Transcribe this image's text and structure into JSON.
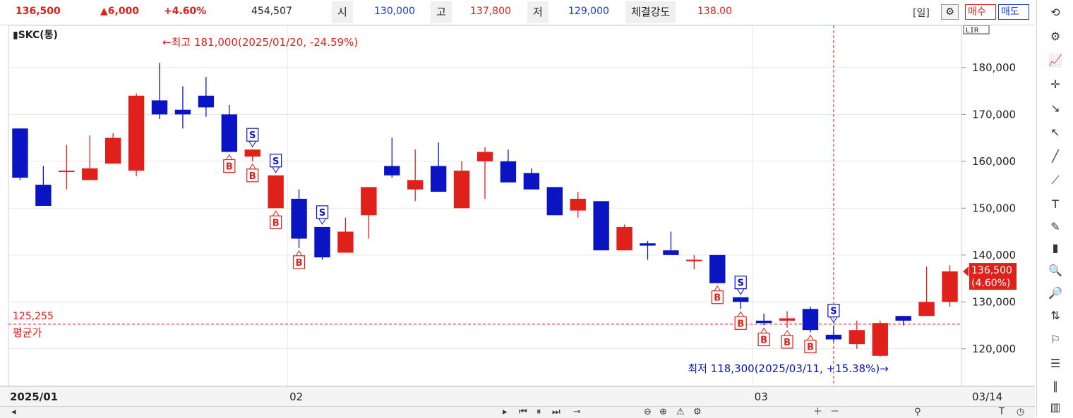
{
  "header": {
    "price": "136,500",
    "change": "▲6,000",
    "change_pct": "+4.60%",
    "volume": "454,507",
    "open_label": "시",
    "open": "130,000",
    "high_label": "고",
    "high": "137,800",
    "low_label": "저",
    "low": "129,000",
    "strength_label": "체결강도",
    "strength": "138.00",
    "period": "[일]",
    "buy_label": "매수",
    "sell_label": "매도"
  },
  "colors": {
    "up": "#e0201a",
    "down": "#0a14c2",
    "avg": "#e0201a",
    "grid": "#e6e6e6"
  },
  "chart_data": {
    "type": "candlestick",
    "symbol_label": "SKC(통)",
    "scale_badge": "LIR",
    "ylim": [
      112000,
      189000
    ],
    "yticks": [
      120000,
      130000,
      140000,
      150000,
      160000,
      170000,
      180000
    ],
    "ytick_labels": [
      "120,000",
      "130,000",
      "140,000",
      "150,000",
      "160,000",
      "170,000",
      "180,000"
    ],
    "x_labels": [
      {
        "index": 0,
        "text": "2025/01"
      },
      {
        "index": 12,
        "text": "02"
      },
      {
        "index": 32,
        "text": "03"
      },
      {
        "index": 43,
        "text": "03/14"
      }
    ],
    "candles": [
      {
        "o": 167000,
        "h": 167000,
        "l": 156000,
        "c": 156500
      },
      {
        "o": 155000,
        "h": 159000,
        "l": 150500,
        "c": 150500
      },
      {
        "o": 158000,
        "h": 163500,
        "l": 154000,
        "c": 158000
      },
      {
        "o": 156000,
        "h": 165500,
        "l": 156000,
        "c": 158500
      },
      {
        "o": 159500,
        "h": 166000,
        "l": 159500,
        "c": 165000
      },
      {
        "o": 158000,
        "h": 174500,
        "l": 156800,
        "c": 174000
      },
      {
        "o": 173000,
        "h": 181000,
        "l": 169000,
        "c": 170000
      },
      {
        "o": 171000,
        "h": 176000,
        "l": 167000,
        "c": 170000
      },
      {
        "o": 174000,
        "h": 178000,
        "l": 169500,
        "c": 171500
      },
      {
        "o": 170000,
        "h": 172000,
        "l": 162000,
        "c": 162000
      },
      {
        "o": 161000,
        "h": 162500,
        "l": 160000,
        "c": 162500
      },
      {
        "o": 150000,
        "h": 157000,
        "l": 150000,
        "c": 157000
      },
      {
        "o": 152000,
        "h": 154000,
        "l": 141500,
        "c": 143500
      },
      {
        "o": 146000,
        "h": 146000,
        "l": 139000,
        "c": 139500
      },
      {
        "o": 140500,
        "h": 148000,
        "l": 140500,
        "c": 145000
      },
      {
        "o": 148500,
        "h": 154500,
        "l": 143500,
        "c": 154500
      },
      {
        "o": 159000,
        "h": 165000,
        "l": 156500,
        "c": 157000
      },
      {
        "o": 154000,
        "h": 162500,
        "l": 151500,
        "c": 156000
      },
      {
        "o": 159000,
        "h": 164000,
        "l": 153500,
        "c": 153500
      },
      {
        "o": 150000,
        "h": 160000,
        "l": 150000,
        "c": 158000
      },
      {
        "o": 160000,
        "h": 163000,
        "l": 152000,
        "c": 162000
      },
      {
        "o": 160000,
        "h": 162500,
        "l": 155500,
        "c": 155500
      },
      {
        "o": 157500,
        "h": 158500,
        "l": 154000,
        "c": 154000
      },
      {
        "o": 154500,
        "h": 154500,
        "l": 148500,
        "c": 148500
      },
      {
        "o": 149500,
        "h": 153500,
        "l": 148000,
        "c": 152000
      },
      {
        "o": 151500,
        "h": 151500,
        "l": 141000,
        "c": 141000
      },
      {
        "o": 141000,
        "h": 146500,
        "l": 141000,
        "c": 146000
      },
      {
        "o": 142500,
        "h": 143000,
        "l": 139000,
        "c": 142000
      },
      {
        "o": 141000,
        "h": 145000,
        "l": 140500,
        "c": 140000
      },
      {
        "o": 139000,
        "h": 140000,
        "l": 137000,
        "c": 139000
      },
      {
        "o": 140000,
        "h": 140000,
        "l": 134000,
        "c": 134000
      },
      {
        "o": 131000,
        "h": 131000,
        "l": 128500,
        "c": 130000
      },
      {
        "o": 126000,
        "h": 127500,
        "l": 125000,
        "c": 125500
      },
      {
        "o": 126000,
        "h": 128000,
        "l": 124500,
        "c": 126500
      },
      {
        "o": 128500,
        "h": 129000,
        "l": 123500,
        "c": 124000
      },
      {
        "o": 123000,
        "h": 125000,
        "l": 121500,
        "c": 122000
      },
      {
        "o": 121000,
        "h": 126000,
        "l": 120000,
        "c": 124000
      },
      {
        "o": 118500,
        "h": 126000,
        "l": 118300,
        "c": 125500
      },
      {
        "o": 127000,
        "h": 127000,
        "l": 125000,
        "c": 126000
      },
      {
        "o": 127000,
        "h": 137500,
        "l": 127000,
        "c": 130000
      },
      {
        "o": 130000,
        "h": 137800,
        "l": 129000,
        "c": 136500
      }
    ],
    "avg_line": {
      "value": 125255,
      "value_label": "125,255",
      "label": "평균가"
    },
    "high_annotation": {
      "index": 6,
      "text": "←최고 181,000(2025/01/20, -24.59%)"
    },
    "low_annotation": {
      "index": 37,
      "text": "최저 118,300(2025/03/11, +15.38%)→"
    },
    "current_price_badge": {
      "price": "136,500",
      "pct": "(4.60%)"
    },
    "crosshair_index": 35,
    "signals": [
      {
        "index": 9,
        "type": "B",
        "below": true
      },
      {
        "index": 10,
        "type": "S",
        "below": false
      },
      {
        "index": 10,
        "type": "B",
        "below": true
      },
      {
        "index": 11,
        "type": "S",
        "below": false
      },
      {
        "index": 11,
        "type": "B",
        "below": true
      },
      {
        "index": 12,
        "type": "B",
        "below": true
      },
      {
        "index": 13,
        "type": "S",
        "below": false
      },
      {
        "index": 30,
        "type": "B",
        "below": true
      },
      {
        "index": 31,
        "type": "S",
        "below": false
      },
      {
        "index": 31,
        "type": "B",
        "below": true
      },
      {
        "index": 32,
        "type": "B",
        "below": true
      },
      {
        "index": 33,
        "type": "B",
        "below": true
      },
      {
        "index": 34,
        "type": "B",
        "below": true
      },
      {
        "index": 35,
        "type": "S",
        "below": false
      }
    ]
  },
  "toolbar_icons": [
    "refresh-icon",
    "gear-icon",
    "indicator-icon",
    "crosshair-icon",
    "trend-icon",
    "arrow-icon",
    "line-icon",
    "auto-line-icon",
    "text-icon",
    "all-icon",
    "candle-icon",
    "zoom-in-icon",
    "zoom-list-icon",
    "scale-icon",
    "pattern-icon",
    "fib-icon",
    "bars-icon",
    "grid-icon"
  ]
}
